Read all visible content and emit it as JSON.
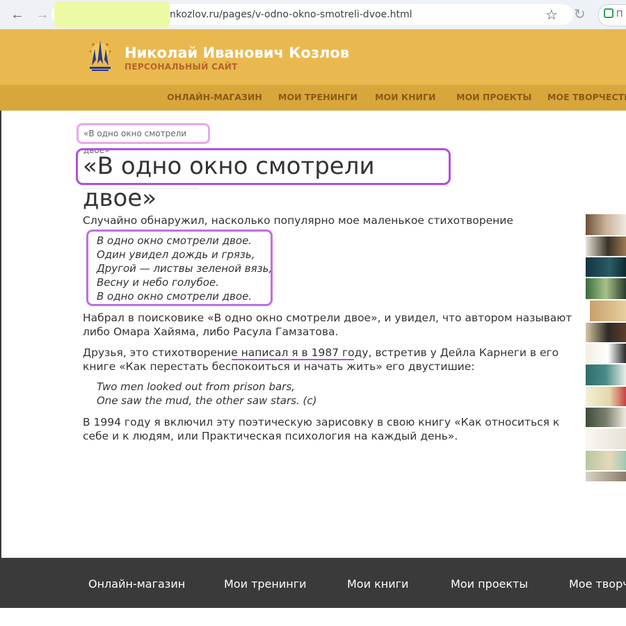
{
  "browser": {
    "url": "nkozlov.ru/pages/v-odno-okno-smotreli-dvoe.html",
    "back_icon": "←",
    "forward_icon": "→",
    "star_icon": "☆",
    "reload_icon": "↻",
    "ext_label": "П"
  },
  "site": {
    "title": "Николай Иванович Козлов",
    "subtitle": "ПЕРСОНАЛЬНЫЙ САЙТ",
    "header_color": "#e9b94f"
  },
  "top_nav": [
    {
      "label": "ОНЛАЙН-МАГАЗИН"
    },
    {
      "label": "МОИ ТРЕНИНГИ"
    },
    {
      "label": "МОИ КНИГИ"
    },
    {
      "label": "МОИ ПРОЕКТЫ"
    },
    {
      "label": "МОЕ ТВОРЧЕСТВО"
    }
  ],
  "page": {
    "breadcrumb": "«В одно окно смотрели двое»",
    "title": "«В одно окно смотрели двое»"
  },
  "article": {
    "intro": "Случайно обнаружил, насколько популярно мое маленькое стихотворение",
    "poem": [
      "В одно окно смотрели двое.",
      "Один увидел дождь и грязь,",
      "Другой — листвы зеленой вязь,",
      "Весну и небо голубое.",
      "В одно окно смотрели двое."
    ],
    "p2": "Набрал в поисковике «В одно окно смотрели двое», и увидел, что автором называют либо Омара Хайяма, либо Расула Гамзатова.",
    "p3_before": "Друзья, это стихотворение ",
    "p3_highlight": "написал я в 1987 году,",
    "p3_after": " встретив у Дейла Карнеги в его книге «Как перестать беспокоиться и начать жить» его двустишие:",
    "quote": [
      "Two men looked out from prison bars,",
      "One saw the mud, the other saw stars. (c)"
    ],
    "p4": "В 1994 году я включил эту поэтическую зарисовку в свою книгу «Как относиться к себе и к людям, или Практическая психология на каждый день»."
  },
  "footer_nav": [
    {
      "label": "Онлайн-магазин"
    },
    {
      "label": "Мои тренинги"
    },
    {
      "label": "Мои книги"
    },
    {
      "label": "Мои проекты"
    },
    {
      "label": "Мое творч"
    }
  ]
}
